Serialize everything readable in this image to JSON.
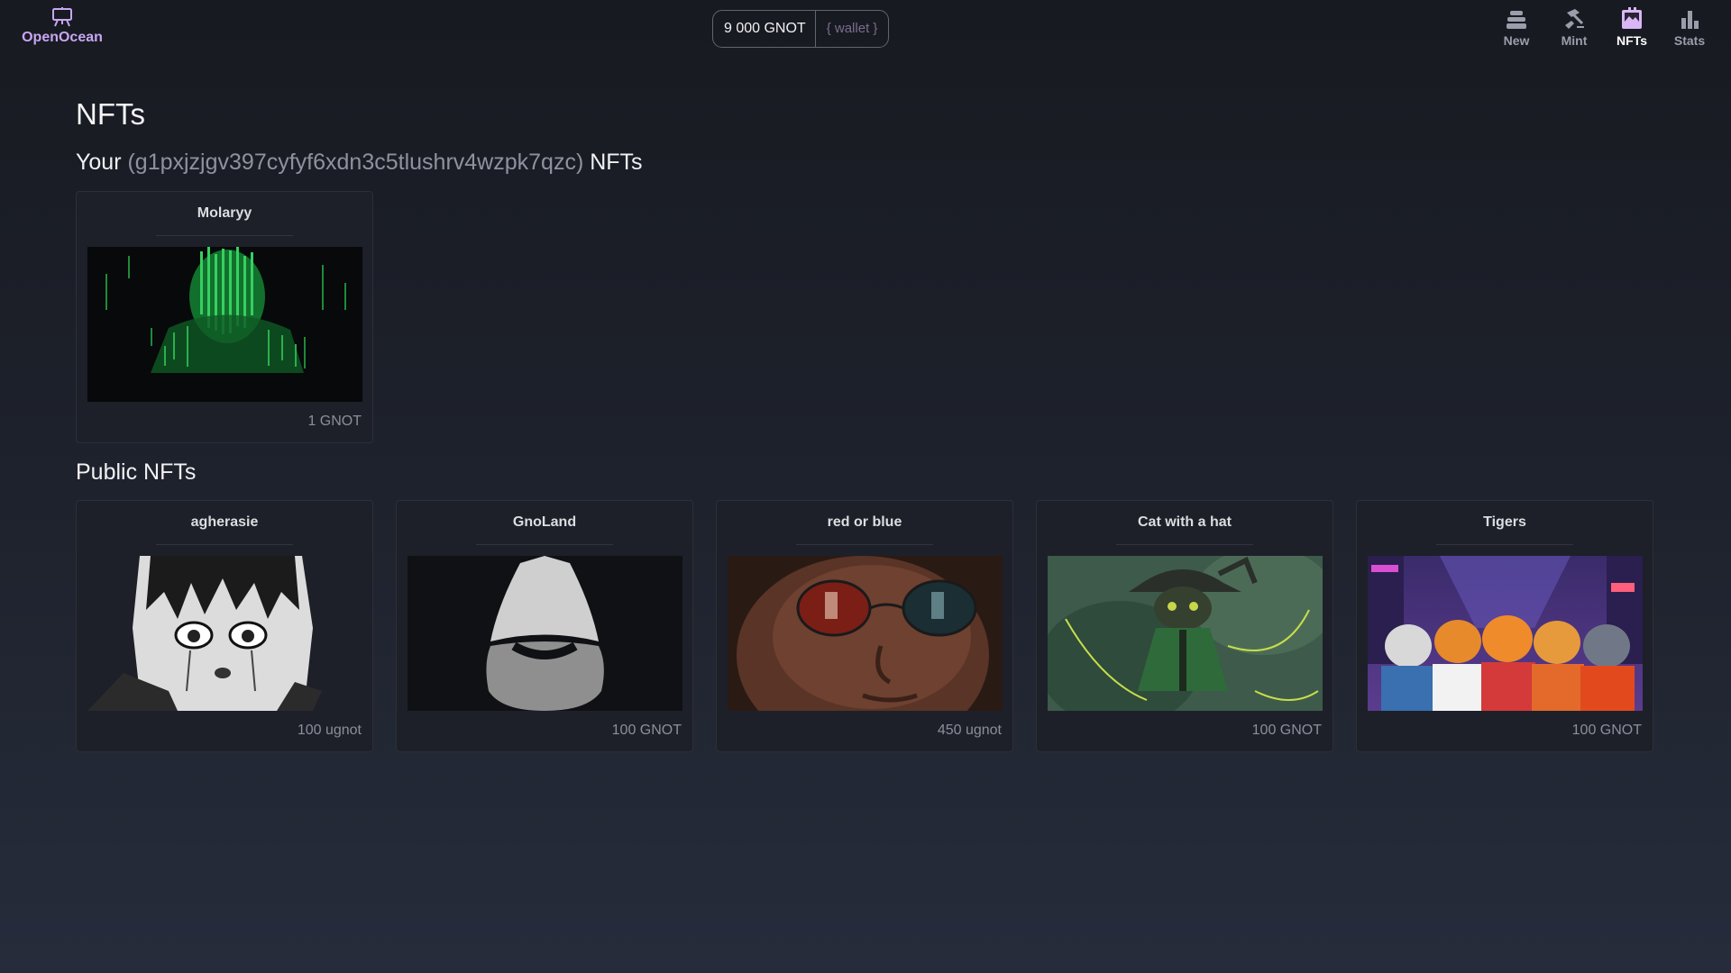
{
  "brand": {
    "name": "OpenOcean",
    "icon": "easel-icon",
    "color": "#c8a6f2"
  },
  "wallet": {
    "balance": "9 000 GNOT",
    "button_label": "{ wallet }"
  },
  "nav": [
    {
      "label": "New",
      "icon": "layers-icon",
      "active": false
    },
    {
      "label": "Mint",
      "icon": "hammer-icon",
      "active": false
    },
    {
      "label": "NFTs",
      "icon": "gallery-icon",
      "active": true
    },
    {
      "label": "Stats",
      "icon": "bar-chart-icon",
      "active": false
    }
  ],
  "page": {
    "title": "NFTs",
    "your_prefix": "Your",
    "address": "(g1pxjzjgv397cyfyf6xdn3c5tlushrv4wzpk7qzc)",
    "your_suffix": "NFTs",
    "public_title": "Public NFTs"
  },
  "your_nfts": [
    {
      "title": "Molaryy",
      "price": "1 GNOT",
      "image": "green-matrix-code-face"
    }
  ],
  "public_nfts": [
    {
      "title": "agherasie",
      "price": "100 ugnot",
      "image": "manga-girl-sketch"
    },
    {
      "title": "GnoLand",
      "price": "100 GNOT",
      "image": "gnome-silhouette"
    },
    {
      "title": "red or blue",
      "price": "450 ugnot",
      "image": "sunglasses-reflection"
    },
    {
      "title": "Cat with a hat",
      "price": "100 GNOT",
      "image": "cat-in-hat-illustration"
    },
    {
      "title": "Tigers",
      "price": "100 GNOT",
      "image": "tiger-group-neon-city"
    }
  ],
  "colors": {
    "accent": "#c8a6f2",
    "muted": "#8b8f9a",
    "background": "#1b1e27"
  }
}
